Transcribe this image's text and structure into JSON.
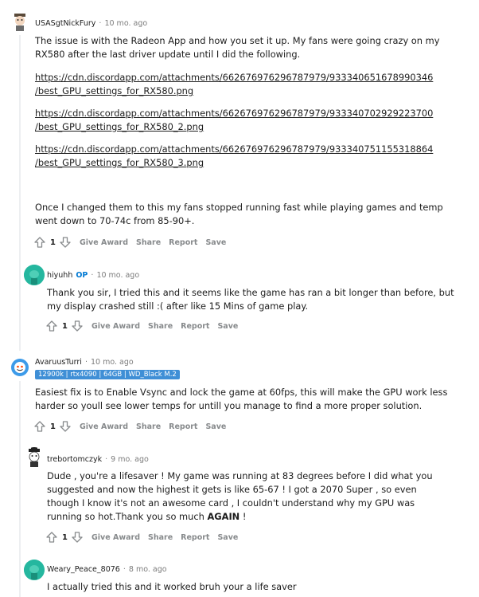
{
  "comments": [
    {
      "username": "USASgtNickFury",
      "time": "10 mo. ago",
      "paragraphs": [
        "The issue is with the Radeon App and how you set it up. My fans were going crazy on my RX580 after the last driver update until I did the following."
      ],
      "links": [
        {
          "line1": "https://cdn.discordapp.com/attachments/662676976296787979/933340651678990346",
          "line2": "/best_GPU_settings_for_RX580.png"
        },
        {
          "line1": "https://cdn.discordapp.com/attachments/662676976296787979/933340702929223700",
          "line2": "/best_GPU_settings_for_RX580_2.png"
        },
        {
          "line1": "https://cdn.discordapp.com/attachments/662676976296787979/933340751155318864",
          "line2": "/best_GPU_settings_for_RX580_3.png"
        }
      ],
      "closing": "Once I changed them to this my fans stopped running fast while playing games and temp went down to 70-74c from 85-90+.",
      "score": "1"
    },
    {
      "username": "hiyuhh",
      "op_badge": "OP",
      "time": "10 mo. ago",
      "text": "Thank you sir, I tried this and it seems like the game has ran a bit longer than before, but my display crashed still :( after like 15 Mins of game play.",
      "score": "1"
    },
    {
      "username": "AvaruusTurri",
      "time": "10 mo. ago",
      "flair": "12900k | rtx4090 | 64GB | WD_Black M.2",
      "text": "Easiest fix is to Enable Vsync and lock the game at 60fps, this will make the GPU work less harder so youll see lower temps for untill you manage to find a more proper solution.",
      "score": "1"
    },
    {
      "username": "trebortomczyk",
      "time": "9 mo. ago",
      "text_before": "Dude , you're a lifesaver ! My game was running at 83 degrees before I did what you suggested and now the highest it gets is like 65-67 ! I got a 2070 Super , so even though I know it's not an awesome card , I couldn't understand why my GPU was running so hot.Thank you so much ",
      "text_bold": "AGAIN",
      "text_after": " !",
      "score": "1"
    },
    {
      "username": "Weary_Peace_8076",
      "time": "8 mo. ago",
      "text": "I actually tried this and it worked bruh your a life saver"
    }
  ],
  "actions": {
    "give_award": "Give Award",
    "share": "Share",
    "report": "Report",
    "save": "Save"
  },
  "dot": "·",
  "icons": [
    "upvote-icon",
    "downvote-icon",
    "snoo-avatar-icon"
  ],
  "colors": {
    "op": "#0079d3",
    "flair_bg": "#3f8fd6",
    "muted": "#878a8c",
    "avatar_teal": "#25b79f",
    "avatar_blue": "#3d9be9"
  }
}
